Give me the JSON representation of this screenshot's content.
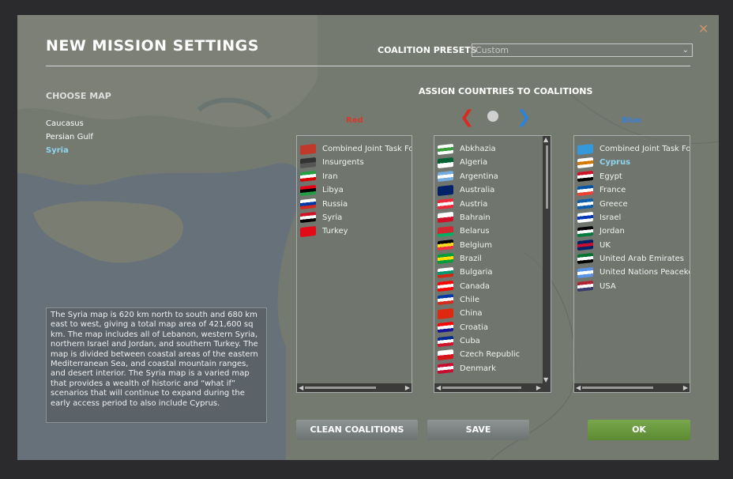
{
  "window": {
    "title": "NEW MISSION SETTINGS",
    "close_icon": "close-icon"
  },
  "presets": {
    "label": "COALITION PRESETS",
    "selected": "Custom"
  },
  "choose_map": {
    "label": "CHOOSE MAP",
    "maps": [
      {
        "label": "Caucasus",
        "active": false
      },
      {
        "label": "Persian Gulf",
        "active": false
      },
      {
        "label": "Syria",
        "active": true
      }
    ]
  },
  "description": "The Syria map is 620 km north to south and 680 km east to west, giving a total map area of 421,600 sq km. The map includes all of Lebanon, western Syria, northern Israel and Jordan, and southern Turkey. The map is divided between coastal areas of the eastern Mediterranean Sea, and coastal mountain ranges, and desert interior. The Syria map is a varied map that provides a wealth of historic and “what if” scenarios that will continue to expand during the early access period to also include Cyprus.",
  "assign": {
    "label": "ASSIGN COUNTRIES TO COALITIONS",
    "red_label": "Red",
    "blue_label": "Blue"
  },
  "red_coalition": [
    {
      "name": "Combined Joint Task Fo",
      "flag": [
        "#c0392b",
        "#c0392b"
      ]
    },
    {
      "name": "Insurgents",
      "flag": [
        "#333333",
        "#555555"
      ]
    },
    {
      "name": "Iran",
      "flag": [
        "#239f40",
        "#ffffff",
        "#da0000"
      ]
    },
    {
      "name": "Libya",
      "flag": [
        "#e70013",
        "#000000",
        "#239e46"
      ]
    },
    {
      "name": "Russia",
      "flag": [
        "#ffffff",
        "#0039a6",
        "#d52b1e"
      ]
    },
    {
      "name": "Syria",
      "flag": [
        "#ce1126",
        "#ffffff",
        "#000000"
      ]
    },
    {
      "name": "Turkey",
      "flag": [
        "#e30a17",
        "#e30a17"
      ]
    }
  ],
  "neutral_countries": [
    {
      "name": "Abkhazia",
      "flag": [
        "#ffffff",
        "#3a9b3a",
        "#ffffff"
      ]
    },
    {
      "name": "Algeria",
      "flag": [
        "#006233",
        "#ffffff"
      ]
    },
    {
      "name": "Argentina",
      "flag": [
        "#74acdf",
        "#ffffff",
        "#74acdf"
      ]
    },
    {
      "name": "Australia",
      "flag": [
        "#012169",
        "#012169"
      ]
    },
    {
      "name": "Austria",
      "flag": [
        "#ed2939",
        "#ffffff",
        "#ed2939"
      ]
    },
    {
      "name": "Bahrain",
      "flag": [
        "#ffffff",
        "#ce1126"
      ]
    },
    {
      "name": "Belarus",
      "flag": [
        "#d22730",
        "#d22730",
        "#00af66"
      ]
    },
    {
      "name": "Belgium",
      "flag": [
        "#000000",
        "#fdda24",
        "#ef3340"
      ]
    },
    {
      "name": "Brazil",
      "flag": [
        "#009c3b",
        "#ffdf00",
        "#009c3b"
      ]
    },
    {
      "name": "Bulgaria",
      "flag": [
        "#ffffff",
        "#00966e",
        "#d62612"
      ]
    },
    {
      "name": "Canada",
      "flag": [
        "#ff0000",
        "#ffffff",
        "#ff0000"
      ]
    },
    {
      "name": "Chile",
      "flag": [
        "#0039a6",
        "#ffffff",
        "#d52b1e"
      ]
    },
    {
      "name": "China",
      "flag": [
        "#de2910",
        "#de2910"
      ]
    },
    {
      "name": "Croatia",
      "flag": [
        "#ff0000",
        "#ffffff",
        "#171796"
      ]
    },
    {
      "name": "Cuba",
      "flag": [
        "#002a8f",
        "#ffffff",
        "#cf142b"
      ]
    },
    {
      "name": "Czech Republic",
      "flag": [
        "#ffffff",
        "#d7141a"
      ]
    },
    {
      "name": "Denmark",
      "flag": [
        "#c60c30",
        "#ffffff",
        "#c60c30"
      ]
    }
  ],
  "blue_coalition": [
    {
      "name": "Combined Joint Task Fo",
      "flag": [
        "#3498db",
        "#3498db"
      ],
      "highlight": false
    },
    {
      "name": "Cyprus",
      "flag": [
        "#ffffff",
        "#d57800",
        "#ffffff"
      ],
      "highlight": true
    },
    {
      "name": "Egypt",
      "flag": [
        "#ce1126",
        "#ffffff",
        "#000000"
      ],
      "highlight": false
    },
    {
      "name": "France",
      "flag": [
        "#0055a4",
        "#ffffff",
        "#ef4135"
      ],
      "highlight": false
    },
    {
      "name": "Greece",
      "flag": [
        "#0d5eaf",
        "#ffffff",
        "#0d5eaf"
      ],
      "highlight": false
    },
    {
      "name": "Israel",
      "flag": [
        "#ffffff",
        "#0038b8",
        "#ffffff"
      ],
      "highlight": false
    },
    {
      "name": "Jordan",
      "flag": [
        "#000000",
        "#ffffff",
        "#007a3d"
      ],
      "highlight": false
    },
    {
      "name": "UK",
      "flag": [
        "#012169",
        "#c8102e",
        "#012169"
      ],
      "highlight": false
    },
    {
      "name": "United Arab Emirates",
      "flag": [
        "#00732f",
        "#ffffff",
        "#000000"
      ],
      "highlight": false
    },
    {
      "name": "United Nations Peaceke",
      "flag": [
        "#5b92e5",
        "#ffffff",
        "#5b92e5"
      ],
      "highlight": false
    },
    {
      "name": "USA",
      "flag": [
        "#b22234",
        "#ffffff",
        "#3c3b6e"
      ],
      "highlight": false
    }
  ],
  "buttons": {
    "clean": "CLEAN COALITIONS",
    "save": "SAVE",
    "ok": "OK"
  },
  "colors": {
    "accent_cyan": "#8fd6ef",
    "red": "#d63a2a",
    "blue": "#3a7fd6",
    "ok_green": "#6a9a3f"
  }
}
